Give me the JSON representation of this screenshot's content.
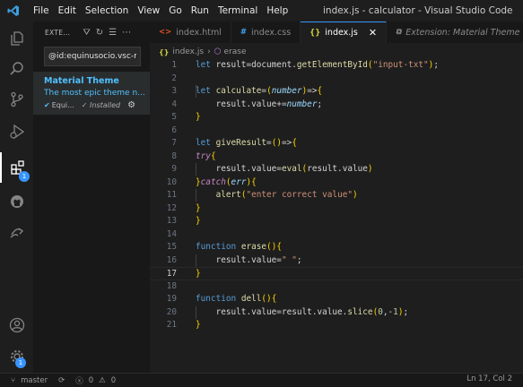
{
  "titlebar": {
    "menu": [
      "File",
      "Edit",
      "Selection",
      "View",
      "Go",
      "Run",
      "Terminal",
      "Help"
    ],
    "title": "index.js - calculator - Visual Studio Code"
  },
  "activity": {
    "extensions_badge": "1",
    "manage_badge": "1"
  },
  "sidebar": {
    "title": "EXTE...",
    "search_value": "@id:equinusocio.vsc-m",
    "extension": {
      "name": "Material Theme",
      "description": "The most epic theme n...",
      "publisher": "Equi...",
      "status": "Installed"
    }
  },
  "tabs": [
    {
      "label": "index.html",
      "icon": "html-icon"
    },
    {
      "label": "index.css",
      "icon": "css-icon"
    },
    {
      "label": "index.js",
      "icon": "js-icon"
    },
    {
      "label": "Extension: Material Theme",
      "icon": "extension-icon"
    }
  ],
  "breadcrumb": {
    "file": "index.js",
    "symbol": "erase"
  },
  "editor": {
    "current_line": 17,
    "lines": [
      "let result=document.getElementById(\"input-txt\");",
      "",
      "let calculate=(number)=>{",
      "    result.value+=number;",
      "}",
      "",
      "let giveResult=()=>{",
      "try{",
      "    result.value=eval(result.value)",
      "}catch(err){",
      "    alert(\"enter correct value\")",
      "}",
      "}",
      "",
      "function erase(){",
      "    result.value=\" \";",
      "}",
      "",
      "function dell(){",
      "    result.value=result.value.slice(0,-1);",
      "}"
    ]
  },
  "statusbar": {
    "branch": "master",
    "errors": "0",
    "warnings": "0",
    "cursor": "Ln 17, Col 2"
  }
}
